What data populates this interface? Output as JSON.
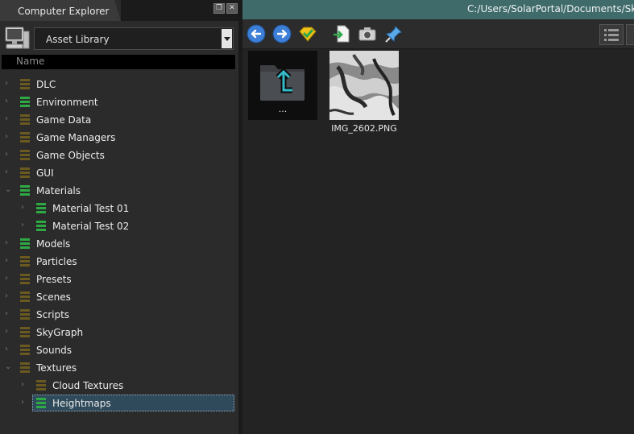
{
  "panel": {
    "title": "Computer Explorer",
    "float_glyph": "❐",
    "close_glyph": "✕"
  },
  "library": {
    "selected": "Asset Library"
  },
  "tree_header": "Name",
  "tree": [
    {
      "label": "DLC",
      "color": "#6b5a20"
    },
    {
      "label": "Environment",
      "color": "#2eaa44"
    },
    {
      "label": "Game Data",
      "color": "#6b5a20"
    },
    {
      "label": "Game Managers",
      "color": "#6b5a20"
    },
    {
      "label": "Game Objects",
      "color": "#6b5a20"
    },
    {
      "label": "GUI",
      "color": "#6b5a20"
    },
    {
      "label": "Materials",
      "color": "#2eaa44",
      "expanded": true
    },
    {
      "label": "Material Test 01",
      "color": "#2eaa44",
      "child": true
    },
    {
      "label": "Material Test 02",
      "color": "#2eaa44",
      "child": true
    },
    {
      "label": "Models",
      "color": "#2eaa44"
    },
    {
      "label": "Particles",
      "color": "#6b5a20"
    },
    {
      "label": "Presets",
      "color": "#6b5a20"
    },
    {
      "label": "Scenes",
      "color": "#6b5a20"
    },
    {
      "label": "Scripts",
      "color": "#6b5a20"
    },
    {
      "label": "SkyGraph",
      "color": "#6b5a20"
    },
    {
      "label": "Sounds",
      "color": "#6b5a20"
    },
    {
      "label": "Textures",
      "color": "#6b5a20",
      "expanded": true
    },
    {
      "label": "Cloud Textures",
      "color": "#6b5a20",
      "child": true
    },
    {
      "label": "Heightmaps",
      "color": "#2eaa44",
      "child": true,
      "selected": true
    }
  ],
  "path": "C:/Users/SolarPortal/Documents/Sky",
  "toolbar": [
    "back-icon",
    "forward-icon",
    "favorite-icon",
    "import-icon",
    "camera-icon",
    "pin-icon",
    "list-view-icon"
  ],
  "files": [
    {
      "name": "...",
      "kind": "parent-folder"
    },
    {
      "name": "IMG_2602.PNG",
      "kind": "heightmap-image"
    }
  ]
}
